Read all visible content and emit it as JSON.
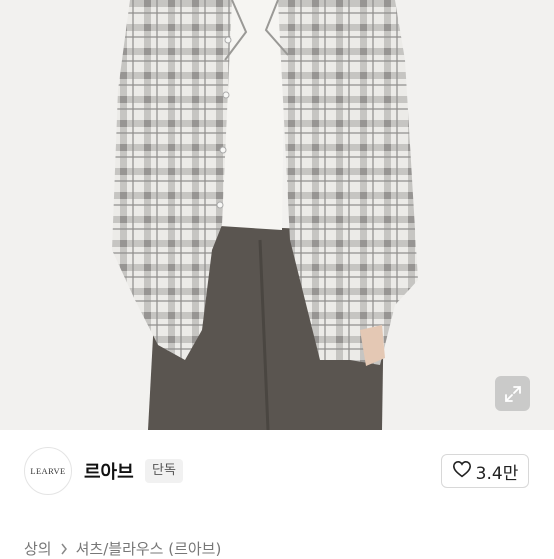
{
  "product_image": {
    "alt": "",
    "expand_icon": "expand-arrows-icon"
  },
  "shop": {
    "logo_text": "LEARVE",
    "name": "르아브",
    "badge": "단독"
  },
  "like": {
    "icon": "heart-outline-icon",
    "count": "3.4만"
  },
  "breadcrumb": {
    "items": [
      "상의",
      "셔츠/블라우스 (르아브)"
    ],
    "separator_icon": "chevron-right-icon"
  },
  "colors": {
    "background": "#ffffff",
    "text_primary": "#111111",
    "text_secondary": "#777777",
    "badge_bg": "#f1f1f1"
  }
}
